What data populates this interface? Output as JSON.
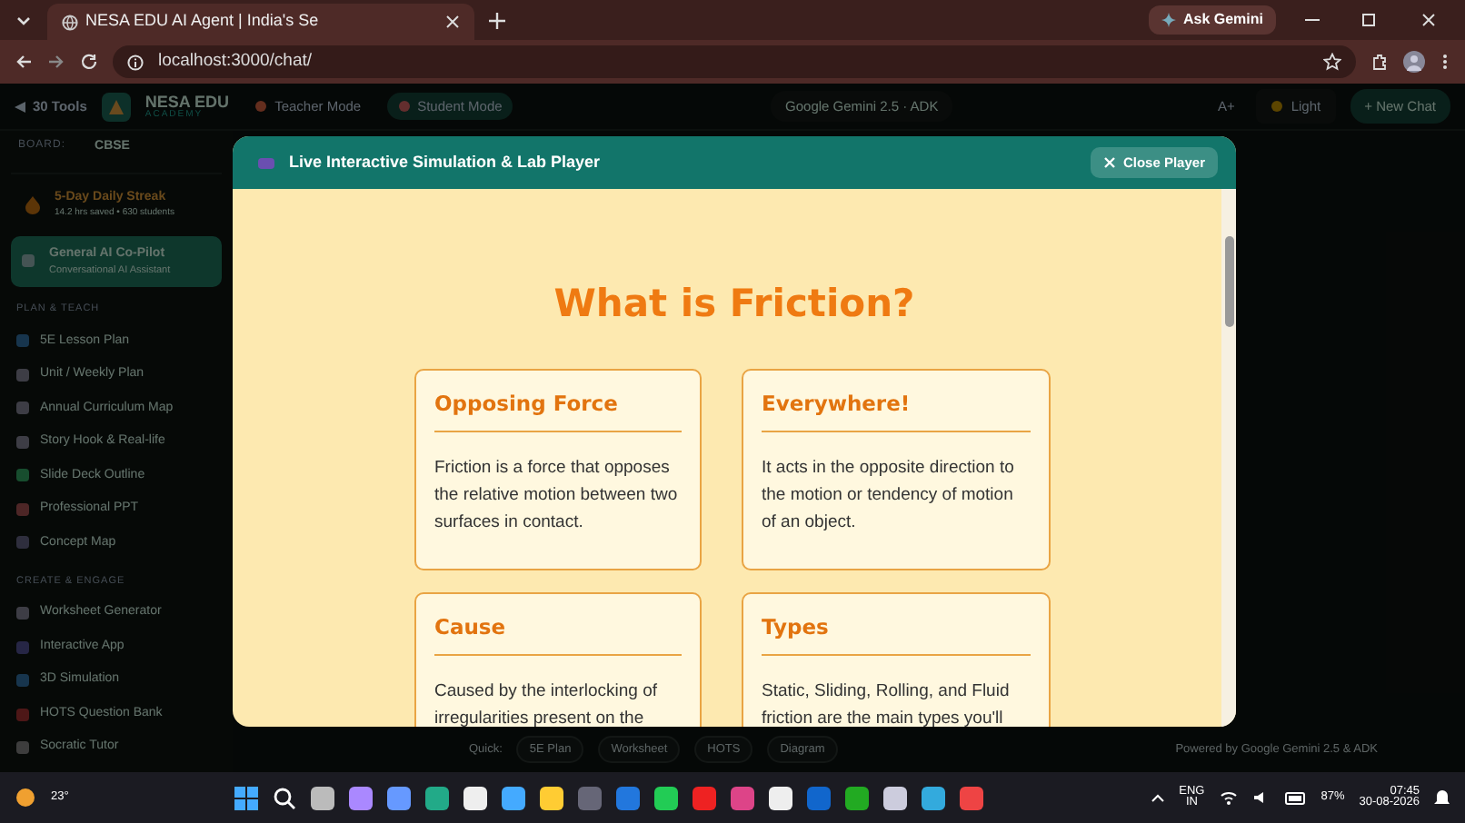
{
  "browser": {
    "tab_title": "NESA EDU AI Agent | India's Se",
    "ask_gemini": "Ask Gemini",
    "url": "localhost:3000/chat/"
  },
  "app_header": {
    "tools_button": "30 Tools",
    "brand_name": "NESA EDU",
    "brand_subtitle": "ACADEMY",
    "modes": [
      {
        "label": "Teacher Mode",
        "selected": false
      },
      {
        "label": "Student Mode",
        "selected": true
      }
    ],
    "model_badge": "Google Gemini 2.5 · ADK",
    "font_button": "A+",
    "theme_button": "Light",
    "new_chat": "+ New Chat"
  },
  "sidebar": {
    "board_label": "BOARD:",
    "board_value": "CBSE",
    "streak": {
      "title": "5-Day Daily Streak",
      "subtitle": "14.2 hrs saved • 630 students"
    },
    "copilot": {
      "title": "General AI Co-Pilot",
      "subtitle": "Conversational AI Assistant",
      "selected": true
    },
    "sections": [
      {
        "heading": "PLAN & TEACH",
        "items": [
          "5E Lesson Plan",
          "Unit / Weekly Plan",
          "Annual Curriculum Map",
          "Story Hook & Real-life",
          "Slide Deck Outline",
          "Professional PPT",
          "Concept Map"
        ]
      },
      {
        "heading": "CREATE & ENGAGE",
        "items": [
          "Worksheet Generator",
          "Interactive App",
          "3D Simulation",
          "HOTS Question Bank",
          "Socratic Tutor"
        ]
      }
    ]
  },
  "quick_bar": {
    "label": "Quick:",
    "buttons": [
      "5E Plan",
      "Worksheet",
      "HOTS",
      "Diagram"
    ],
    "powered": "Powered by Google Gemini 2.5 & ADK"
  },
  "modal": {
    "title": "Live Interactive Simulation & Lab Player",
    "close_label": "Close Player",
    "heading": "What is Friction?",
    "cards": [
      {
        "title": "Opposing Force",
        "text": "Friction is a force that opposes the relative motion between two surfaces in contact."
      },
      {
        "title": "Everywhere!",
        "text": "It acts in the opposite direction to the motion or tendency of motion of an object."
      },
      {
        "title": "Cause",
        "text": "Caused by the interlocking of irregularities present on the"
      },
      {
        "title": "Types",
        "text": "Static, Sliding, Rolling, and Fluid friction are the main types you'll"
      }
    ]
  },
  "taskbar": {
    "weather": "23°",
    "lang": "ENG",
    "region": "IN",
    "battery": "87%",
    "time": "07:45",
    "date": "30-08-2026"
  }
}
